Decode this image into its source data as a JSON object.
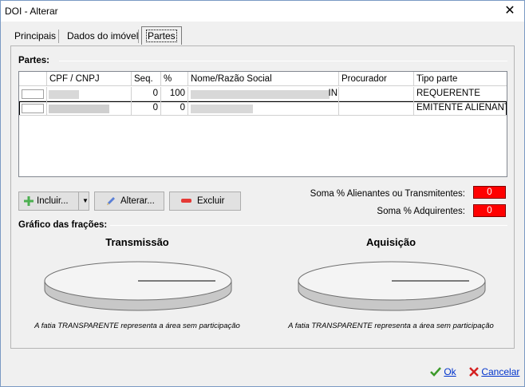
{
  "window": {
    "title": "DOI - Alterar",
    "close_glyph": "✕"
  },
  "tabs": [
    {
      "label": "Principais"
    },
    {
      "label": "Dados do imóvel"
    },
    {
      "label": "Partes"
    }
  ],
  "partes": {
    "group_label": "Partes:",
    "columns": [
      "CPF / CNPJ",
      "Seq.",
      "%",
      "Nome/Razão Social",
      "Procurador",
      "Tipo parte"
    ],
    "rows": [
      {
        "seq": "0",
        "percent": "100",
        "nome_suffix": "IN",
        "tipo": "REQUERENTE"
      },
      {
        "seq": "0",
        "percent": "0",
        "nome_suffix": "",
        "tipo": "EMITENTE ALIENANT"
      }
    ]
  },
  "buttons": {
    "incluir": "Incluir...",
    "alterar": "Alterar...",
    "excluir": "Excluir"
  },
  "sums": {
    "alienantes_label": "Soma % Alienantes ou Transmitentes:",
    "alienantes_value": "0",
    "adquirentes_label": "Soma % Adquirentes:",
    "adquirentes_value": "0"
  },
  "grafico": {
    "group_label": "Gráfico das frações:",
    "transmissao_title": "Transmissão",
    "aquisicao_title": "Aquisição",
    "caption": "A fatia TRANSPARENTE representa a área sem participação"
  },
  "footer": {
    "ok": "Ok",
    "cancelar": "Cancelar"
  },
  "colors": {
    "sum_alert": "#ff0000",
    "ok_check": "#3c9a2a",
    "cancel_x": "#d42020"
  }
}
